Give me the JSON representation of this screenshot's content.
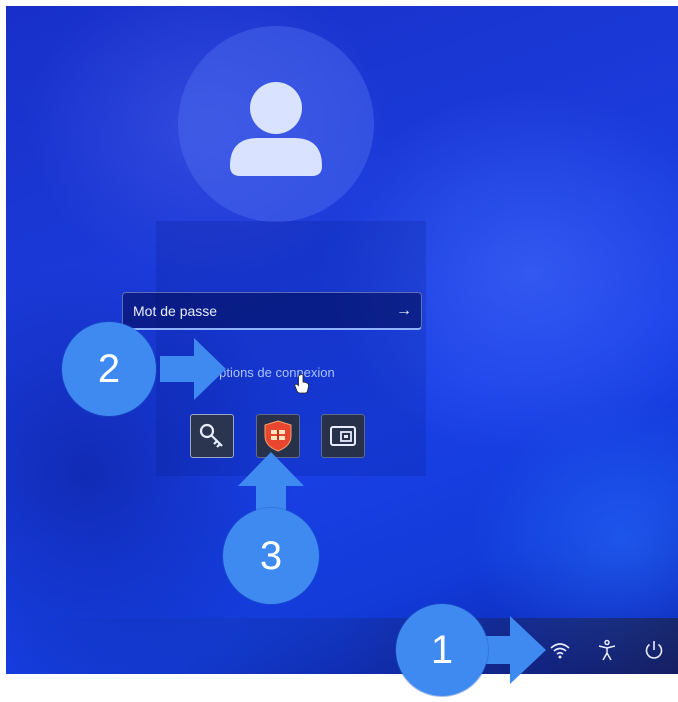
{
  "lock_screen": {
    "password_field": {
      "placeholder": "Mot de passe",
      "submit_arrow": "→"
    },
    "sign_in_options_link": "Options de connexion",
    "sign_in_options": [
      {
        "icon": "key-icon"
      },
      {
        "icon": "security-shield-icon"
      },
      {
        "icon": "certificate-card-icon"
      }
    ],
    "tray_icons": [
      "wifi-icon",
      "accessibility-icon",
      "power-icon"
    ]
  },
  "annotations": {
    "step_1": "1",
    "step_2": "2",
    "step_3": "3",
    "badge_color": "#3f8af0"
  }
}
